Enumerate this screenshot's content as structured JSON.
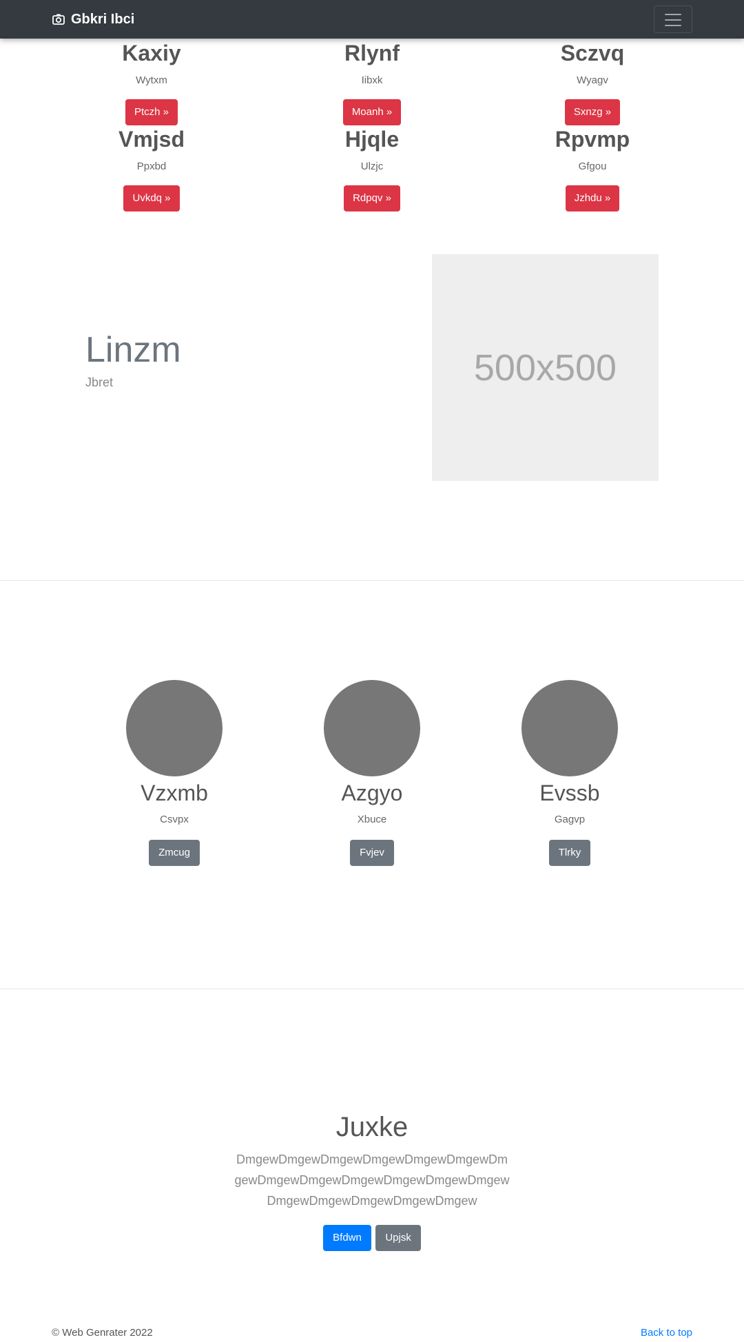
{
  "navbar": {
    "brand_icon": "camera-icon",
    "brand": "Gbkri Ibci",
    "toggler_icon": "hamburger-menu-icon",
    "bg_color": "#343a40"
  },
  "features": [
    {
      "title": "Kaxiy",
      "subtitle": "Wytxm",
      "button": "Ptczh »"
    },
    {
      "title": "Rlynf",
      "subtitle": "Iibxk",
      "button": "Moanh »"
    },
    {
      "title": "Sczvq",
      "subtitle": "Wyagv",
      "button": "Sxnzg »"
    },
    {
      "title": "Vmjsd",
      "subtitle": "Ppxbd",
      "button": "Uvkdq »"
    },
    {
      "title": "Hjqle",
      "subtitle": "Ulzjc",
      "button": "Rdpqv »"
    },
    {
      "title": "Rpvmp",
      "subtitle": "Gfgou",
      "button": "Jzhdu »"
    }
  ],
  "hero": {
    "title": "Linzm",
    "subtitle": "Jbret",
    "image_text": "500x500"
  },
  "team": [
    {
      "name": "Vzxmb",
      "role": "Csvpx",
      "button": "Zmcug"
    },
    {
      "name": "Azgyo",
      "role": "Xbuce",
      "button": "Fvjev"
    },
    {
      "name": "Evssb",
      "role": "Gagvp",
      "button": "Tlrky"
    }
  ],
  "cta": {
    "title": "Juxke",
    "text": "DmgewDmgewDmgewDmgewDmgewDmgewDmgewDmgewDmgewDmgewDmgewDmgewDmgewDmgewDmgewDmgewDmgewDmgew",
    "primary_button": "Bfdwn",
    "secondary_button": "Upjsk"
  },
  "footer": {
    "copyright": "© Web Genrater 2022",
    "back_to_top": "Back to top"
  },
  "colors": {
    "danger": "#dc3545",
    "primary": "#007bff",
    "secondary": "#6c757d"
  }
}
